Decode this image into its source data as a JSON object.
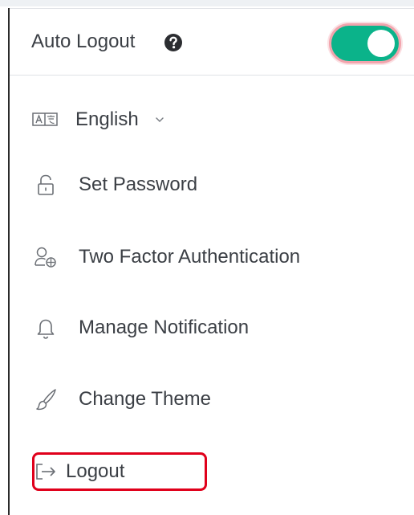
{
  "header": {
    "auto_logout_label": "Auto Logout",
    "help_icon": "question-circle-icon",
    "toggle_state": "on",
    "toggle_color": "#0bb38a"
  },
  "menu": {
    "language": {
      "label": "English",
      "icon": "language-icon",
      "chevron": "chevron-down-icon"
    },
    "set_password": {
      "label": "Set Password",
      "icon": "lock-icon"
    },
    "two_factor": {
      "label": "Two Factor Authentication",
      "icon": "user-shield-icon"
    },
    "notifications": {
      "label": "Manage Notification",
      "icon": "bell-icon"
    },
    "theme": {
      "label": "Change Theme",
      "icon": "brush-icon"
    },
    "logout": {
      "label": "Logout",
      "icon": "logout-icon",
      "highlight_color": "#e0001b"
    }
  }
}
